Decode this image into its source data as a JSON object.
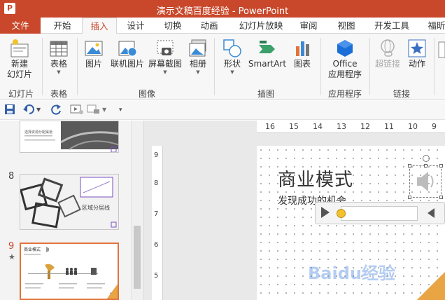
{
  "titlebar": {
    "app_icon": "P",
    "title": "演示文稿百度经验 - PowerPoint"
  },
  "tabs": [
    "文件",
    "开始",
    "插入",
    "设计",
    "切换",
    "动画",
    "幻灯片放映",
    "审阅",
    "视图",
    "开发工具",
    "福昕"
  ],
  "active_tab": "插入",
  "ribbon": {
    "buttons": {
      "new_slide": [
        "新建",
        "幻灯片"
      ],
      "table": "表格",
      "picture": "图片",
      "online_picture": "联机图片",
      "screenshot": "屏幕截图",
      "album": "相册",
      "shapes": "形状",
      "smartart": "SmartArt",
      "chart": "图表",
      "office_apps": [
        "Office",
        "应用程序"
      ],
      "hyperlink": "超链接",
      "action": "动作"
    },
    "groups": {
      "slides": "幻灯片",
      "tables": "表格",
      "images": "图像",
      "illustrations": "插图",
      "apps": "应用程序",
      "links": "链接"
    }
  },
  "qat": {
    "save_icon": "save-icon",
    "undo_icon": "undo-icon",
    "redo_icon": "redo-icon"
  },
  "thumbnails": {
    "slide7_text": "选择资源分配渠道",
    "slide8_num": "8",
    "slide8_text": "区域分层线",
    "slide9_num": "9",
    "slide9_star": "★",
    "slide9_title": "商业模式"
  },
  "ruler": {
    "h": [
      "16",
      "15",
      "14",
      "13",
      "12",
      "11",
      "10",
      "9"
    ],
    "v": [
      "9",
      "8",
      "7",
      "6",
      "5"
    ]
  },
  "slide": {
    "title": "商业模式",
    "subtitle": "发现成功的机会"
  },
  "watermark": "Baidu经验",
  "colors": {
    "accent": "#c9472a",
    "selected_border": "#e1743a",
    "knob": "#f3c22a"
  }
}
